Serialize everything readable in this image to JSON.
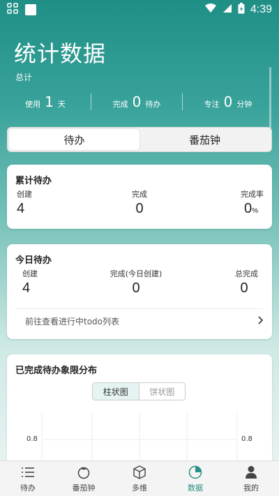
{
  "status_bar": {
    "time": "4:39"
  },
  "header": {
    "title": "统计数据",
    "subtitle": "总计",
    "summary": [
      {
        "label": "使用",
        "value": "1",
        "unit": "天"
      },
      {
        "label": "完成",
        "value": "0",
        "unit": "待办"
      },
      {
        "label": "专注",
        "value": "0",
        "unit": "分钟"
      }
    ]
  },
  "segment": {
    "tab_todo": "待办",
    "tab_pomodoro": "番茄钟",
    "active": "待办"
  },
  "cumulative": {
    "title": "累计待办",
    "created_label": "创建",
    "created_value": "4",
    "completed_label": "完成",
    "completed_value": "0",
    "rate_label": "完成率",
    "rate_value": "0",
    "rate_unit": "%"
  },
  "today": {
    "title": "今日待办",
    "created_label": "创建",
    "created_value": "4",
    "completed_today_label": "完成(今日创建)",
    "completed_today_value": "0",
    "total_completed_label": "总完成",
    "total_completed_value": "0",
    "link_label": "前往查看进行中todo列表"
  },
  "distribution": {
    "title": "已完成待办象限分布",
    "toggle_bar": "柱状图",
    "toggle_pie": "饼状图",
    "axis_tick_left": "0.8",
    "axis_tick_right": "0.8"
  },
  "nav": [
    {
      "label": "待办",
      "icon": "list-icon"
    },
    {
      "label": "番茄钟",
      "icon": "tomato-icon"
    },
    {
      "label": "多维",
      "icon": "cube-icon"
    },
    {
      "label": "数据",
      "icon": "pie-chart-icon",
      "active": true
    },
    {
      "label": "我的",
      "icon": "person-icon"
    }
  ],
  "colors": {
    "accent": "#2a8f86",
    "header_bg": "#1f8f86"
  }
}
